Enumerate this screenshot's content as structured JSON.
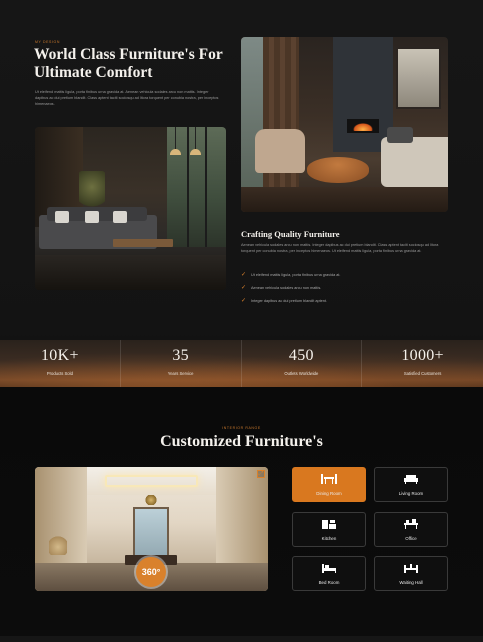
{
  "hero": {
    "eyebrow": "MY DESIGN",
    "title": "World Class Furniture's For Ultimate Comfort",
    "description": "Ut eleifend mattis ligula, porta finibus urna gravida at. Aenean vehicula sodales arcu non mattis. Integer dapibus ac dui pretium blandit. Class aptent taciti sociosqu ad litora torquent per conubia nostra, per inceptos himenaeos."
  },
  "crafting": {
    "title": "Crafting Quality Furniture",
    "description": "Aenean vehicula sodales arcu non mattis. Integer dapibus ac dui pretium blandit. Class aptent taciti sociosqu ad litora torquent per conubia nostra, per inceptos himenaeos. Ut eleifend mattis ligula, porta finibus urna gravida at.",
    "checklist": [
      "Ut eleifend mattis ligula, porta finibus urna gravida at.",
      "Aenean vehicula sodales arcu non mattis.",
      "Integer dapibus ac dui pretium blandit aptent."
    ]
  },
  "stats": [
    {
      "value": "10K+",
      "label": "Products Sold"
    },
    {
      "value": "35",
      "label": "Years Service"
    },
    {
      "value": "450",
      "label": "Outlets Worldwide"
    },
    {
      "value": "1000+",
      "label": "Satisfied Customers"
    }
  ],
  "customized": {
    "eyebrow": "INTERIOR RANGE",
    "title": "Customized Furniture's",
    "viewer_badge": "360°",
    "rooms": [
      {
        "label": "Dining Room",
        "icon": "dining-table-icon",
        "active": true
      },
      {
        "label": "Living Room",
        "icon": "sofa-icon",
        "active": false
      },
      {
        "label": "Kitchen",
        "icon": "kitchen-icon",
        "active": false
      },
      {
        "label": "Office",
        "icon": "office-desk-icon",
        "active": false
      },
      {
        "label": "Bed Room",
        "icon": "bed-icon",
        "active": false
      },
      {
        "label": "Waiting Hall",
        "icon": "waiting-hall-icon",
        "active": false
      }
    ]
  },
  "colors": {
    "accent": "#d9781f",
    "background": "#121212",
    "text": "#f4f1ec"
  }
}
